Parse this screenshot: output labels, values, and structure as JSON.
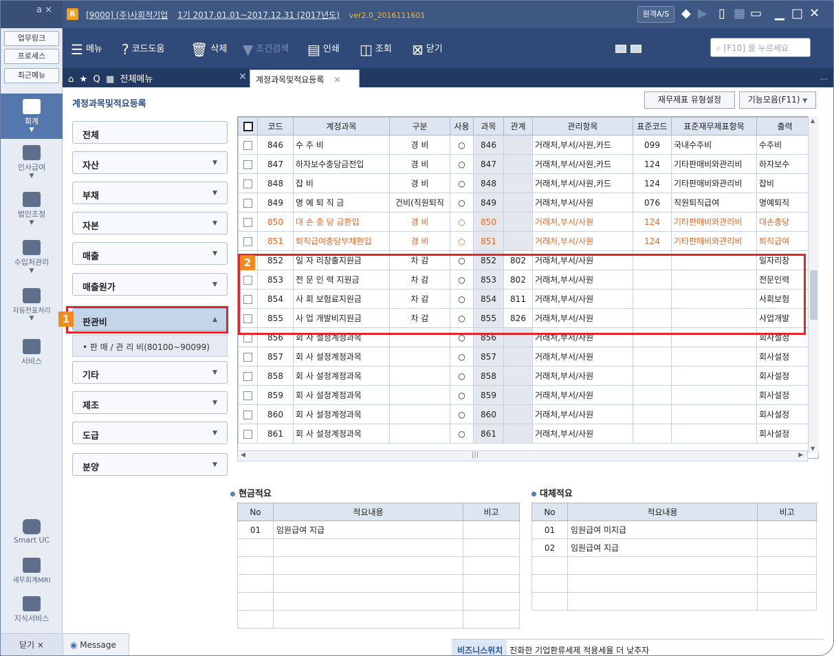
{
  "titlebar": {
    "corner": "a ×",
    "logo": "R",
    "company": "[9000] (주)사회적기업",
    "period": "1기 2017.01.01~2017.12.31 (2017년도)",
    "version": "ver2.0_2016111601",
    "remote_label": "원격A/S"
  },
  "rail": {
    "buttons": [
      "업무링크",
      "프로세스",
      "최근메뉴"
    ],
    "nav": [
      "회계",
      "인사급여",
      "법인조정",
      "수입처관리",
      "자동전표처리",
      "서비스"
    ],
    "bottom": [
      "Smart UC",
      "세무회계MRI",
      "지식서비스"
    ],
    "close_label": "닫기 ×"
  },
  "toolbar": {
    "menu": "메뉴",
    "code_help": "코드도움",
    "delete": "삭제",
    "condition_search": "조건검색",
    "print": "인쇄",
    "inquiry": "조회",
    "close": "닫기",
    "search_placeholder": "[F10] 을 누르세요"
  },
  "tabs": {
    "all_menu": "전체메뉴",
    "active_tab": "계정과목및적요등록",
    "more": "..."
  },
  "page": {
    "title": "계정과목및적요등록",
    "fs_type_button": "재무제표 유형설정",
    "func_button": "기능모음(F11)"
  },
  "categories": [
    {
      "label": "전체",
      "dd": ""
    },
    {
      "label": "자산",
      "dd": "▼"
    },
    {
      "label": "부채",
      "dd": "▼"
    },
    {
      "label": "자본",
      "dd": "▼"
    },
    {
      "label": "매출",
      "dd": "▼"
    },
    {
      "label": "매출원가",
      "dd": "▼"
    },
    {
      "label": "판관비",
      "dd": "▲"
    },
    {
      "label": "기타",
      "dd": "▼"
    },
    {
      "label": "제조",
      "dd": "▼"
    },
    {
      "label": "도급",
      "dd": "▼"
    },
    {
      "label": "분양",
      "dd": "▼"
    }
  ],
  "sub_item": "• 판 매 / 관 리 비(80100~90099)",
  "badges": [
    "1",
    "2"
  ],
  "grid": {
    "columns": [
      "코드",
      "계정과목",
      "구분",
      "사용",
      "과목",
      "관계",
      "관리항목",
      "표준코드",
      "표준재무제표항목",
      "출력"
    ],
    "rows": [
      {
        "code": "846",
        "name": "수 주 비",
        "type": "경 비",
        "use": "○",
        "acct": "846",
        "rel": "",
        "mgmt": "거래처,부서/사원,카드",
        "std": "099",
        "stdname": "국내수주비",
        "out": "수주비"
      },
      {
        "code": "847",
        "name": "하자보수충당금전입",
        "type": "경 비",
        "use": "○",
        "acct": "847",
        "rel": "",
        "mgmt": "거래처,부서/사원,카드",
        "std": "124",
        "stdname": "기타판매비와관리비",
        "out": "하자보수"
      },
      {
        "code": "848",
        "name": "잡 비",
        "type": "경 비",
        "use": "○",
        "acct": "848",
        "rel": "",
        "mgmt": "거래처,부서/사원,카드",
        "std": "124",
        "stdname": "기타판매비와관리비",
        "out": "잡비"
      },
      {
        "code": "849",
        "name": "명 예 퇴 직 금",
        "type": "건비(직원퇴직",
        "use": "○",
        "acct": "849",
        "rel": "",
        "mgmt": "거래처,부서/사원",
        "std": "076",
        "stdname": "직원퇴직급여",
        "out": "명예퇴직"
      },
      {
        "code": "850",
        "name": "대 손 충 당 금환입",
        "type": "경 비",
        "use": "○",
        "acct": "850",
        "rel": "",
        "mgmt": "거래처,부서/사원",
        "std": "124",
        "stdname": "기타판매비와관리비",
        "out": "대손충당"
      },
      {
        "code": "851",
        "name": "퇴직급여충당부채환입",
        "type": "경 비",
        "use": "○",
        "acct": "851",
        "rel": "",
        "mgmt": "거래처,부서/사원",
        "std": "124",
        "stdname": "기타판매비와관리비",
        "out": "퇴직급여"
      },
      {
        "code": "852",
        "name": "일 자 리창출지원금",
        "type": "차 감",
        "use": "○",
        "acct": "852",
        "rel": "802",
        "mgmt": "거래처,부서/사원",
        "std": "",
        "stdname": "",
        "out": "일자리창"
      },
      {
        "code": "853",
        "name": "전 문 인 력 지원금",
        "type": "차 감",
        "use": "○",
        "acct": "853",
        "rel": "802",
        "mgmt": "거래처,부서/사원",
        "std": "",
        "stdname": "",
        "out": "전문인력"
      },
      {
        "code": "854",
        "name": "사 회 보험료지원금",
        "type": "차 감",
        "use": "○",
        "acct": "854",
        "rel": "811",
        "mgmt": "거래처,부서/사원",
        "std": "",
        "stdname": "",
        "out": "사회보험"
      },
      {
        "code": "855",
        "name": "사 업 개발비지원금",
        "type": "차 감",
        "use": "○",
        "acct": "855",
        "rel": "826",
        "mgmt": "거래처,부서/사원",
        "std": "",
        "stdname": "",
        "out": "사업개발"
      },
      {
        "code": "856",
        "name": "회 사 설정계정과목",
        "type": "",
        "use": "○",
        "acct": "856",
        "rel": "",
        "mgmt": "거래처,부서/사원",
        "std": "",
        "stdname": "",
        "out": "회사설정"
      },
      {
        "code": "857",
        "name": "회 사 설정계정과목",
        "type": "",
        "use": "○",
        "acct": "857",
        "rel": "",
        "mgmt": "거래처,부서/사원",
        "std": "",
        "stdname": "",
        "out": "회사설정"
      },
      {
        "code": "858",
        "name": "회 사 설정계정과목",
        "type": "",
        "use": "○",
        "acct": "858",
        "rel": "",
        "mgmt": "거래처,부서/사원",
        "std": "",
        "stdname": "",
        "out": "회사설정"
      },
      {
        "code": "859",
        "name": "회 사 설정계정과목",
        "type": "",
        "use": "○",
        "acct": "859",
        "rel": "",
        "mgmt": "거래처,부서/사원",
        "std": "",
        "stdname": "",
        "out": "회사설정"
      },
      {
        "code": "860",
        "name": "회 사 설정계정과목",
        "type": "",
        "use": "○",
        "acct": "860",
        "rel": "",
        "mgmt": "거래처,부서/사원",
        "std": "",
        "stdname": "",
        "out": "회사설정"
      },
      {
        "code": "861",
        "name": "회 사 설정계정과목",
        "type": "",
        "use": "○",
        "acct": "861",
        "rel": "",
        "mgmt": "거래처,부서/사원",
        "std": "",
        "stdname": "",
        "out": "회사설정"
      }
    ]
  },
  "cash_summary": {
    "title": "현금적요",
    "columns": [
      "No",
      "적요내용",
      "비고"
    ],
    "rows": [
      {
        "no": "01",
        "text": "임원급여 지급",
        "note": ""
      }
    ]
  },
  "transfer_summary": {
    "title": "대체적요",
    "columns": [
      "No",
      "적요내용",
      "비고"
    ],
    "rows": [
      {
        "no": "01",
        "text": "임원급여 미지급",
        "note": ""
      },
      {
        "no": "02",
        "text": "임원급여 지급",
        "note": ""
      }
    ]
  },
  "footer": {
    "message": "Message",
    "biz_label": "비즈니스위치",
    "biz_text": "진화한 기업환류세제 적용세율 더 낮추자"
  },
  "colors": {
    "titlebar": "#3e5783",
    "toolbar": "#2f4a78",
    "highlight": "#e0262b",
    "badge": "#f08c1e",
    "orange_text": "#e46b2a"
  }
}
